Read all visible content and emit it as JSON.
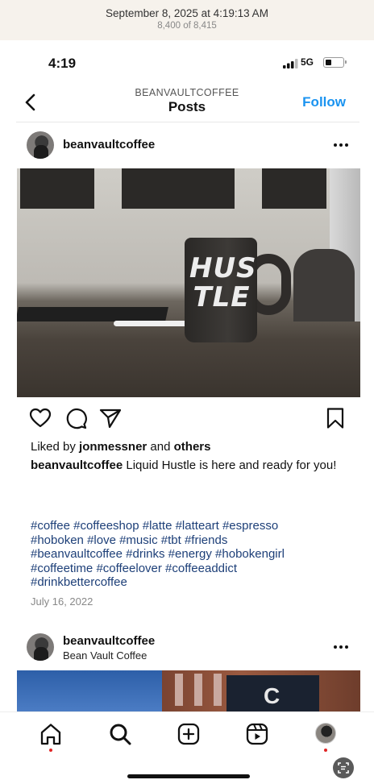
{
  "photos_app": {
    "date": "September 8, 2025 at 4:19:13 AM",
    "count": "8,400 of 8,415"
  },
  "status_bar": {
    "time": "4:19",
    "network": "5G",
    "battery_level": 0.35
  },
  "nav": {
    "account": "BEANVAULTCOFFEE",
    "title": "Posts",
    "follow_label": "Follow"
  },
  "post": {
    "username": "beanvaultcoffee",
    "liked_by_prefix": "Liked by",
    "liked_by_user": "jonmessner",
    "liked_by_and": "and",
    "liked_by_others": "others",
    "caption_user": "beanvaultcoffee",
    "caption_text": "Liquid Hustle is here and ready for you!",
    "image_text": "HUS TLE",
    "hashtag_lines": [
      "#coffee #coffeeshop #latte #latteart #espresso",
      "#hoboken #love #music #tbt #friends",
      "#beanvaultcoffee #drinks #energy #hobokengirl",
      "#coffeetime #coffeelover #coffeeaddict",
      "#drinkbettercoffee"
    ],
    "date": "July 16, 2022"
  },
  "next_post": {
    "username": "beanvaultcoffee",
    "subtitle": "Bean Vault Coffee",
    "image_text": "C"
  },
  "icons": {
    "back": "chevron-left-icon",
    "more": "more-horizontal-icon",
    "like": "heart-icon",
    "comment": "comment-icon",
    "share": "send-icon",
    "save": "bookmark-icon",
    "home": "home-icon",
    "search": "search-icon",
    "create": "plus-square-icon",
    "reels": "reels-icon",
    "live_text": "live-text-icon"
  },
  "colors": {
    "follow_blue": "#1a93f0",
    "hashtag": "#1d3f78",
    "notification_dot": "#e02525"
  }
}
